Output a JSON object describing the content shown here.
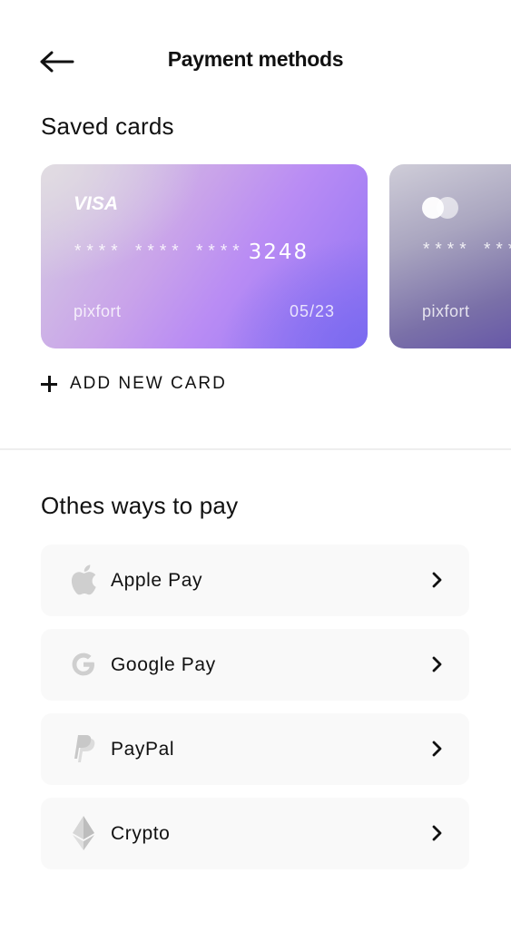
{
  "header": {
    "title": "Payment methods",
    "back_icon": "arrow-left-icon"
  },
  "saved_cards": {
    "title": "Saved cards",
    "cards": [
      {
        "brand": "VISA",
        "masked": "**** **** ****",
        "last4": "3248",
        "holder": "pixfort",
        "expiry": "05/23"
      },
      {
        "brand_icon": "mastercard-icon",
        "masked": "**** ***",
        "holder": "pixfort"
      }
    ],
    "add_label": "ADD NEW CARD",
    "add_icon": "plus-icon"
  },
  "other_ways": {
    "title": "Othes ways to pay",
    "items": [
      {
        "label": "Apple Pay",
        "icon": "apple-icon"
      },
      {
        "label": "Google Pay",
        "icon": "google-icon"
      },
      {
        "label": "PayPal",
        "icon": "paypal-icon"
      },
      {
        "label": "Crypto",
        "icon": "ethereum-icon"
      }
    ],
    "chevron_icon": "chevron-right-icon"
  },
  "colors": {
    "text": "#111111",
    "card_accent": "#8f72f3",
    "list_bg": "#f9f9f9",
    "icon_gray": "#cfcfcf"
  }
}
